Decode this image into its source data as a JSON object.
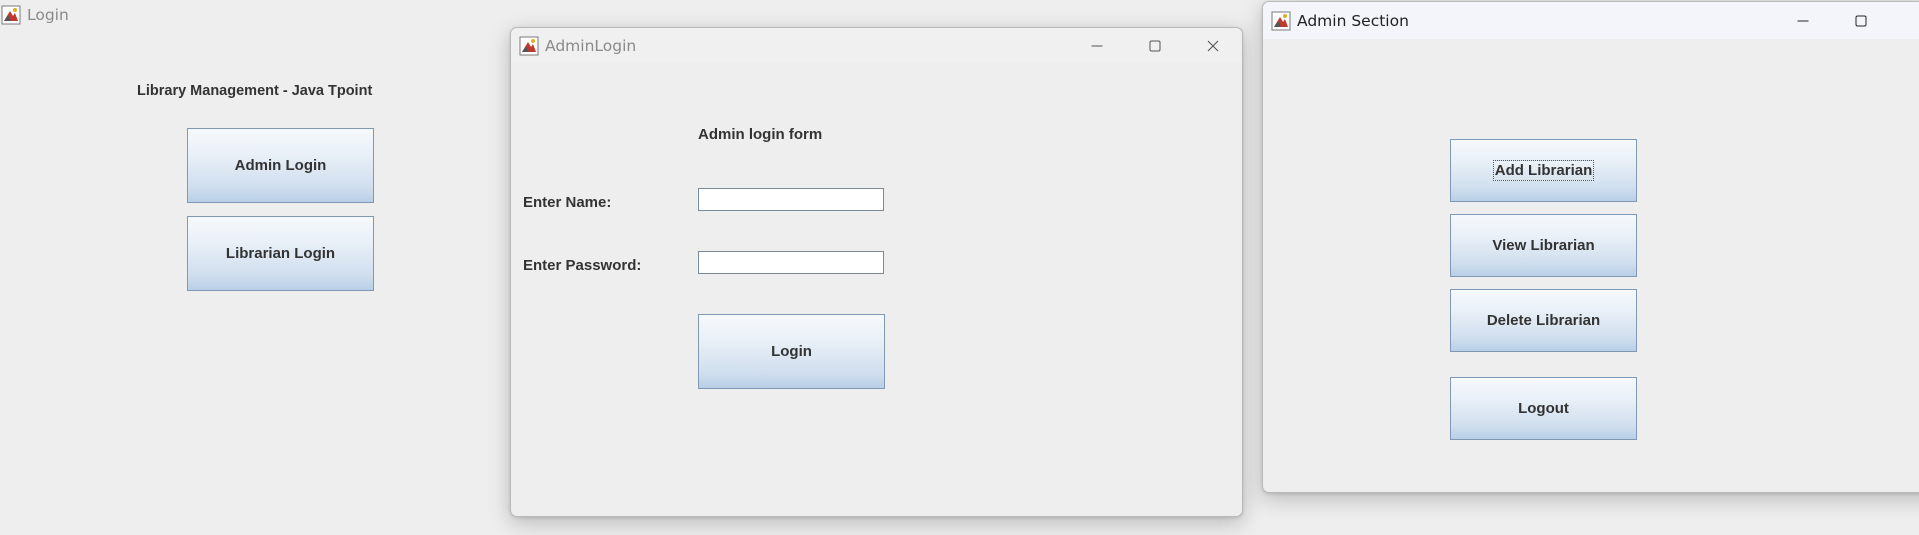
{
  "login_window": {
    "title": "Login",
    "heading": "Library Management - Java Tpoint",
    "admin_login_label": "Admin Login",
    "librarian_login_label": "Librarian Login"
  },
  "admin_login_window": {
    "title": "AdminLogin",
    "heading": "Admin login form",
    "name_label": "Enter Name:",
    "name_value": "",
    "password_label": "Enter Password:",
    "password_value": "",
    "login_label": "Login"
  },
  "admin_section_window": {
    "title": "Admin Section",
    "add_librarian_label": "Add Librarian",
    "view_librarian_label": "View Librarian",
    "delete_librarian_label": "Delete Librarian",
    "logout_label": "Logout"
  },
  "icons": {
    "app": "java-app-icon",
    "minimize": "minimize-icon",
    "maximize": "maximize-icon",
    "close": "close-icon"
  }
}
